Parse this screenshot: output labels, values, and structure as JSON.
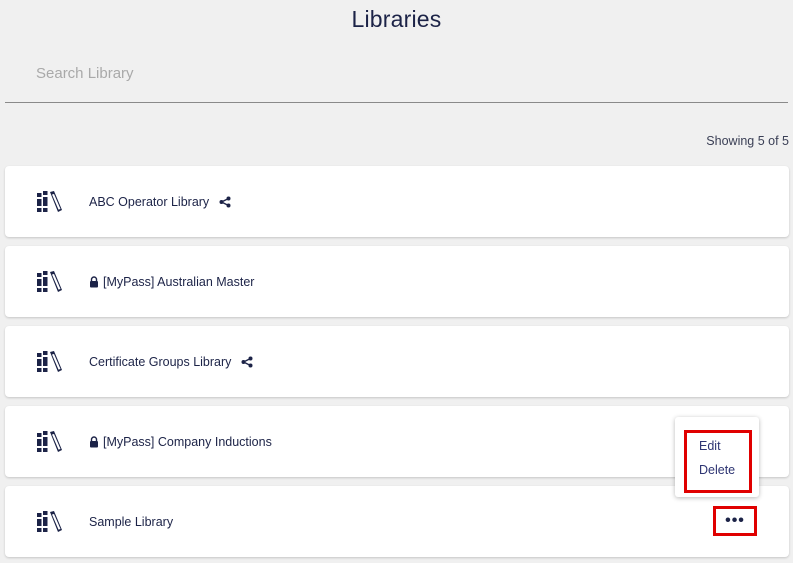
{
  "page": {
    "title": "Libraries"
  },
  "search": {
    "placeholder": "Search Library",
    "value": ""
  },
  "results": {
    "count_text": "Showing 5 of 5"
  },
  "libraries": [
    {
      "name": "ABC Operator Library",
      "locked": false,
      "shared": true
    },
    {
      "name": "[MyPass] Australian Master",
      "locked": true,
      "shared": false
    },
    {
      "name": "Certificate Groups Library",
      "locked": false,
      "shared": true
    },
    {
      "name": "[MyPass] Company Inductions",
      "locked": true,
      "shared": false
    },
    {
      "name": "Sample Library",
      "locked": false,
      "shared": false
    }
  ],
  "more_button": {
    "label": "•••"
  },
  "context_menu": {
    "items": [
      "Edit",
      "Delete"
    ]
  },
  "colors": {
    "text": "#1c2347",
    "highlight": "#e00000",
    "card": "#ffffff",
    "background": "#f0f0f0"
  },
  "icons": {
    "library": "books-icon",
    "lock": "lock-icon",
    "share": "share-icon"
  }
}
